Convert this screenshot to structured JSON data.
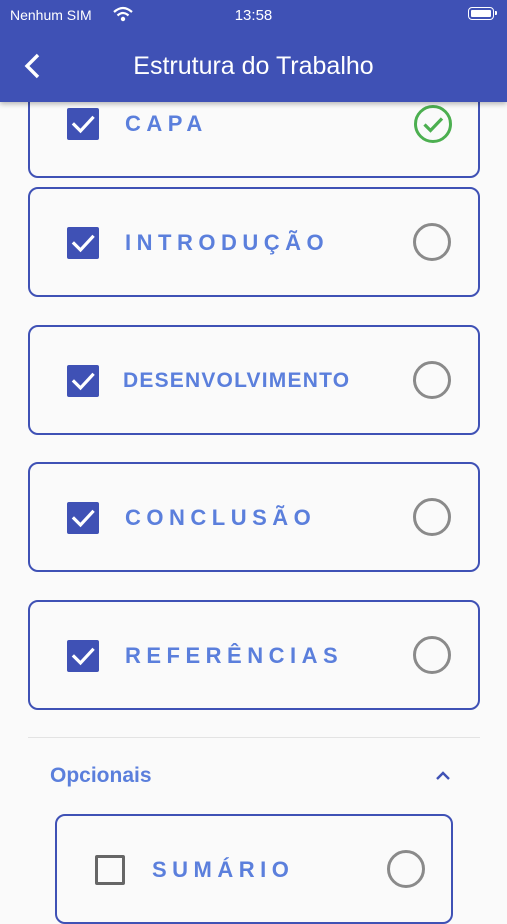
{
  "status_bar": {
    "carrier": "Nenhum SIM",
    "time": "13:58"
  },
  "header": {
    "title": "Estrutura do Trabalho",
    "back_icon": "chevron-left-icon"
  },
  "colors": {
    "primary": "#3f51b5",
    "label": "#5b7fdc",
    "done": "#4caf50",
    "pending": "#8a8a8a"
  },
  "items": [
    {
      "label": "CAPA",
      "checked": true,
      "status": "done"
    },
    {
      "label": "INTRODUÇÃO",
      "checked": true,
      "status": "pending"
    },
    {
      "label": "DESENVOLVIMENTO",
      "checked": true,
      "status": "pending"
    },
    {
      "label": "CONCLUSÃO",
      "checked": true,
      "status": "pending"
    },
    {
      "label": "REFERÊNCIAS",
      "checked": true,
      "status": "pending"
    }
  ],
  "optional_section": {
    "title": "Opcionais",
    "expanded": true,
    "toggle_icon": "chevron-up-icon",
    "items": [
      {
        "label": "SUMÁRIO",
        "checked": false,
        "status": "pending"
      }
    ]
  }
}
